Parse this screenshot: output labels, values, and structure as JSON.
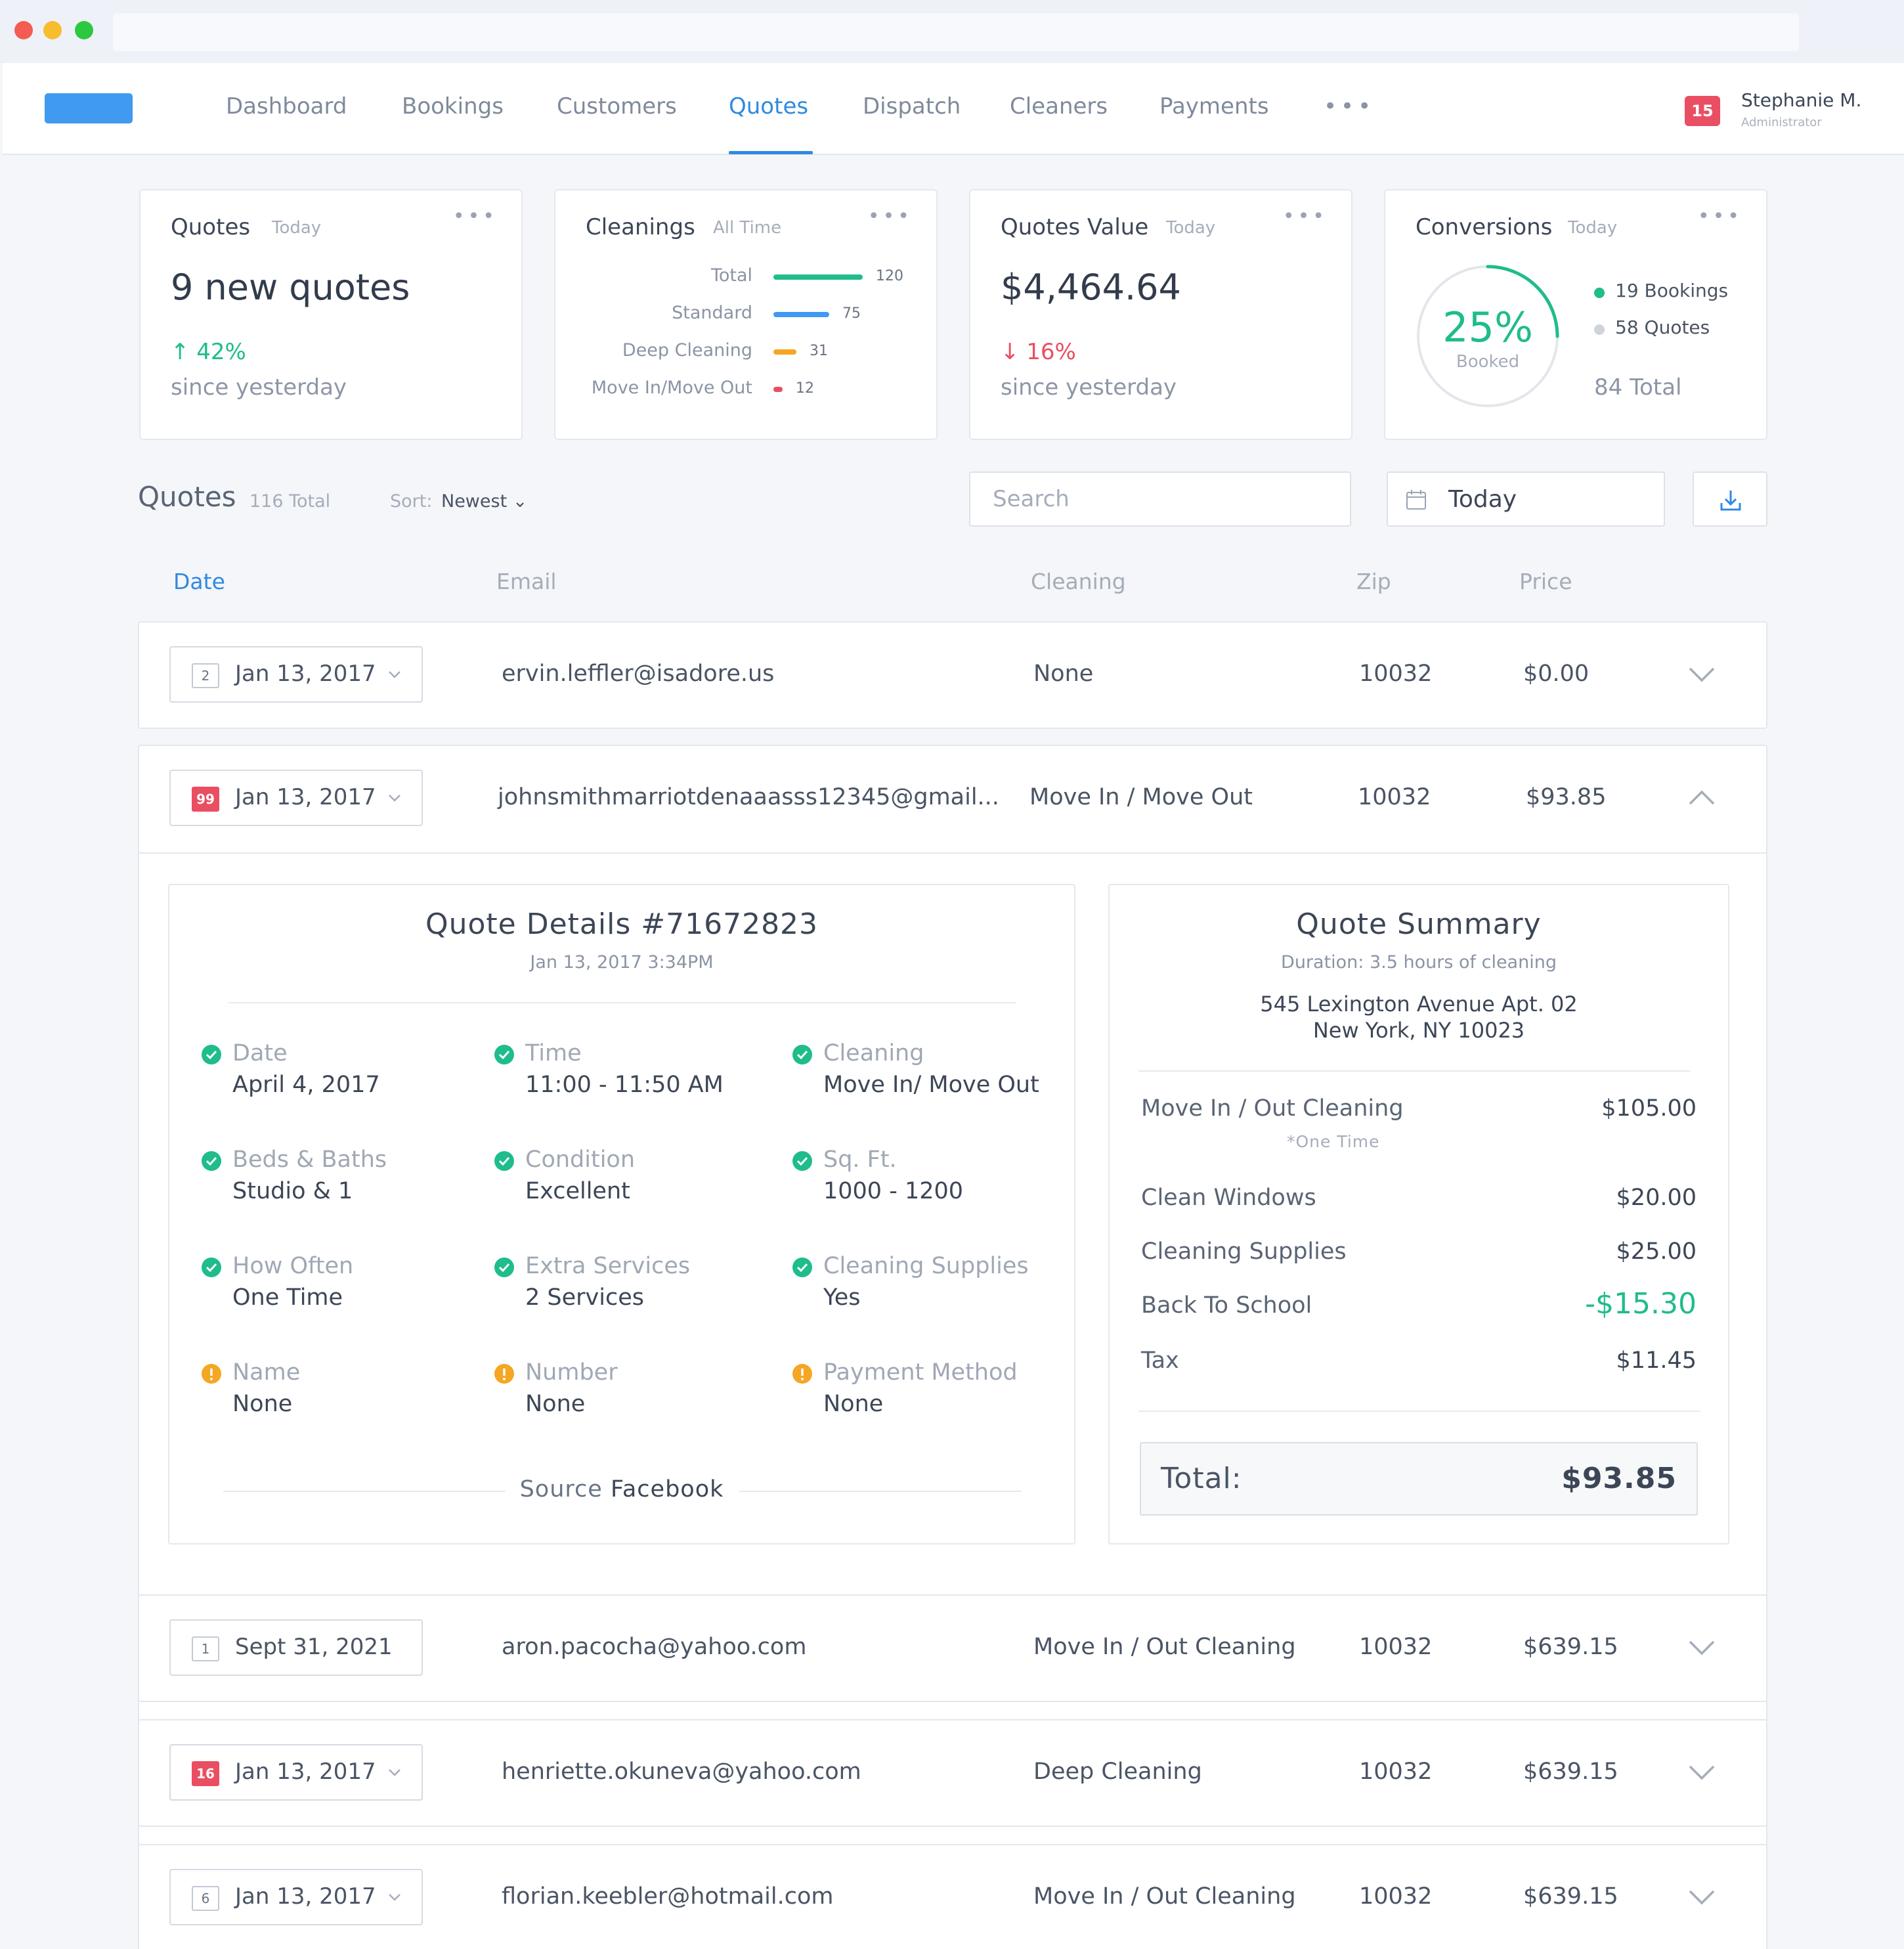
{
  "nav": {
    "items": [
      "Dashboard",
      "Bookings",
      "Customers",
      "Quotes",
      "Dispatch",
      "Cleaners",
      "Payments"
    ],
    "active": "Quotes",
    "more": "•••",
    "notifications": "15",
    "user_name": "Stephanie M.",
    "user_role": "Administrator"
  },
  "cards": {
    "quotes": {
      "title": "Quotes",
      "period": "Today",
      "value": "9 new quotes",
      "trend": "↑ 42%",
      "since": "since yesterday"
    },
    "cleanings": {
      "title": "Cleanings",
      "period": "All Time",
      "bars": [
        {
          "label": "Total",
          "value": 120,
          "color": "#1fbc8c"
        },
        {
          "label": "Standard",
          "value": 75,
          "color": "#3f9af0"
        },
        {
          "label": "Deep Cleaning",
          "value": 31,
          "color": "#f5a623"
        },
        {
          "label": "Move In/Move Out",
          "value": 12,
          "color": "#ea4e62"
        }
      ]
    },
    "value": {
      "title": "Quotes Value",
      "period": "Today",
      "value": "$4,464.64",
      "trend": "↓ 16%",
      "since": "since yesterday"
    },
    "conversions": {
      "title": "Conversions",
      "period": "Today",
      "percent": "25%",
      "percent_value": 0.25,
      "label": "Booked",
      "bookings": "19 Bookings",
      "quotes": "58 Quotes",
      "total": "84 Total",
      "colors": {
        "booked": "#1fbc8c",
        "remaining": "#e3e6eb"
      }
    }
  },
  "list": {
    "title": "Quotes",
    "total": "116 Total",
    "sort_label": "Sort:",
    "sort_value": "Newest ⌄",
    "search_placeholder": "Search",
    "date_filter": "Today"
  },
  "columns": {
    "date": "Date",
    "email": "Email",
    "cleaning": "Cleaning",
    "zip": "Zip",
    "price": "Price"
  },
  "rows": [
    {
      "count": "2",
      "date": "Jan 13, 2017",
      "email": "ervin.leffler@isadore.us",
      "cleaning": "None",
      "zip": "10032",
      "price": "$0.00"
    },
    {
      "count": "99",
      "date": "Jan 13, 2017",
      "email": "johnsmithmarriotdenaaasss12345@gmail...",
      "cleaning": "Move In / Move Out",
      "zip": "10032",
      "price": "$93.85"
    },
    {
      "count": "1",
      "date": "Sept 31, 2021",
      "email": "aron.pacocha@yahoo.com",
      "cleaning": "Move In / Out Cleaning",
      "zip": "10032",
      "price": "$639.15"
    },
    {
      "count": "16",
      "date": "Jan 13, 2017",
      "email": "henriette.okuneva@yahoo.com",
      "cleaning": "Deep Cleaning",
      "zip": "10032",
      "price": "$639.15"
    },
    {
      "count": "6",
      "date": "Jan 13, 2017",
      "email": "florian.keebler@hotmail.com",
      "cleaning": "Move In / Out Cleaning",
      "zip": "10032",
      "price": "$639.15"
    }
  ],
  "details": {
    "title": "Quote Details #71672823",
    "timestamp": "Jan 13, 2017 3:34PM",
    "items": [
      {
        "label": "Date",
        "value": "April 4, 2017",
        "status": "ok"
      },
      {
        "label": "Time",
        "value": "11:00 - 11:50 AM",
        "status": "ok"
      },
      {
        "label": "Cleaning",
        "value": "Move In/ Move Out",
        "status": "ok"
      },
      {
        "label": "Beds & Baths",
        "value": "Studio & 1",
        "status": "ok"
      },
      {
        "label": "Condition",
        "value": "Excellent",
        "status": "ok"
      },
      {
        "label": "Sq. Ft.",
        "value": "1000 - 1200",
        "status": "ok"
      },
      {
        "label": "How Often",
        "value": "One Time",
        "status": "ok"
      },
      {
        "label": "Extra Services",
        "value": "2 Services",
        "status": "ok"
      },
      {
        "label": "Cleaning Supplies",
        "value": "Yes",
        "status": "ok"
      },
      {
        "label": "Name",
        "value": "None",
        "status": "warn"
      },
      {
        "label": "Number",
        "value": "None",
        "status": "warn"
      },
      {
        "label": "Payment Method",
        "value": "None",
        "status": "warn"
      }
    ],
    "source_label": "Source",
    "source_value": "Facebook"
  },
  "summary": {
    "title": "Quote Summary",
    "duration": "Duration: 3.5 hours of cleaning",
    "address_line1": "545 Lexington Avenue Apt. 02",
    "address_line2": "New York, NY 10023",
    "lines": [
      {
        "label": "Move In / Out Cleaning",
        "value": "$105.00",
        "note": "*One Time"
      },
      {
        "label": "Clean Windows",
        "value": "$20.00"
      },
      {
        "label": "Cleaning Supplies",
        "value": "$25.00"
      },
      {
        "label": "Back To School",
        "value": "-$15.30",
        "discount": true
      },
      {
        "label": "Tax",
        "value": "$11.45"
      }
    ],
    "total_label": "Total:",
    "total_value": "$93.85"
  },
  "colors": {
    "accent": "#2f8ae0",
    "success": "#1fbc8c",
    "danger": "#ea4e62",
    "warning": "#f5a623"
  }
}
